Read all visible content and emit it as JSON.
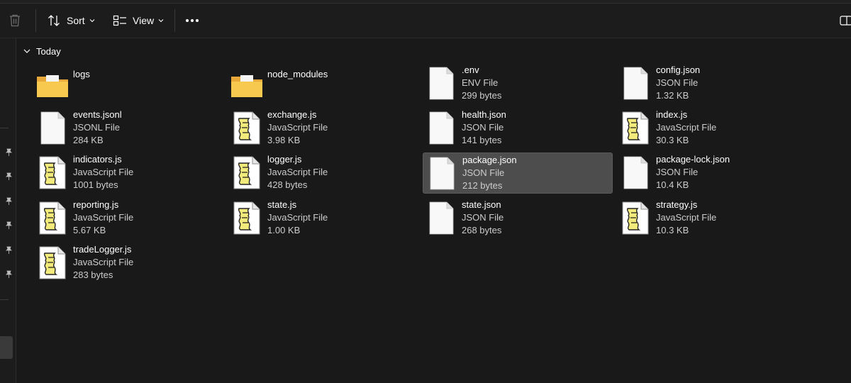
{
  "toolbar": {
    "sort_label": "Sort",
    "view_label": "View",
    "delete_icon": "trash-icon",
    "sort_icon": "sort-arrows-icon",
    "view_icon": "view-list-icon",
    "more_icon": "more-dots-icon",
    "details_icon": "details-pane-icon"
  },
  "colors": {
    "background": "#191919",
    "selection": "#4d4d4d",
    "folder_yellow": "#f3c04a",
    "text_secondary": "#cccccc"
  },
  "group": {
    "label": "Today",
    "expanded": true
  },
  "files": [
    {
      "name": "logs",
      "type": "",
      "size": "",
      "kind": "folder"
    },
    {
      "name": "node_modules",
      "type": "",
      "size": "",
      "kind": "folder"
    },
    {
      "name": ".env",
      "type": "ENV File",
      "size": "299 bytes",
      "kind": "doc"
    },
    {
      "name": "config.json",
      "type": "JSON File",
      "size": "1.32 KB",
      "kind": "doc"
    },
    {
      "name": "events.jsonl",
      "type": "JSONL File",
      "size": "284 KB",
      "kind": "doc"
    },
    {
      "name": "exchange.js",
      "type": "JavaScript File",
      "size": "3.98 KB",
      "kind": "script"
    },
    {
      "name": "health.json",
      "type": "JSON File",
      "size": "141 bytes",
      "kind": "doc"
    },
    {
      "name": "index.js",
      "type": "JavaScript File",
      "size": "30.3 KB",
      "kind": "script"
    },
    {
      "name": "indicators.js",
      "type": "JavaScript File",
      "size": "1001 bytes",
      "kind": "script"
    },
    {
      "name": "logger.js",
      "type": "JavaScript File",
      "size": "428 bytes",
      "kind": "script"
    },
    {
      "name": "package.json",
      "type": "JSON File",
      "size": "212 bytes",
      "kind": "doc",
      "selected": true
    },
    {
      "name": "package-lock.json",
      "type": "JSON File",
      "size": "10.4 KB",
      "kind": "doc"
    },
    {
      "name": "reporting.js",
      "type": "JavaScript File",
      "size": "5.67 KB",
      "kind": "script"
    },
    {
      "name": "state.js",
      "type": "JavaScript File",
      "size": "1.00 KB",
      "kind": "script"
    },
    {
      "name": "state.json",
      "type": "JSON File",
      "size": "268 bytes",
      "kind": "doc"
    },
    {
      "name": "strategy.js",
      "type": "JavaScript File",
      "size": "10.3 KB",
      "kind": "script"
    },
    {
      "name": "tradeLogger.js",
      "type": "JavaScript File",
      "size": "283 bytes",
      "kind": "script"
    }
  ]
}
